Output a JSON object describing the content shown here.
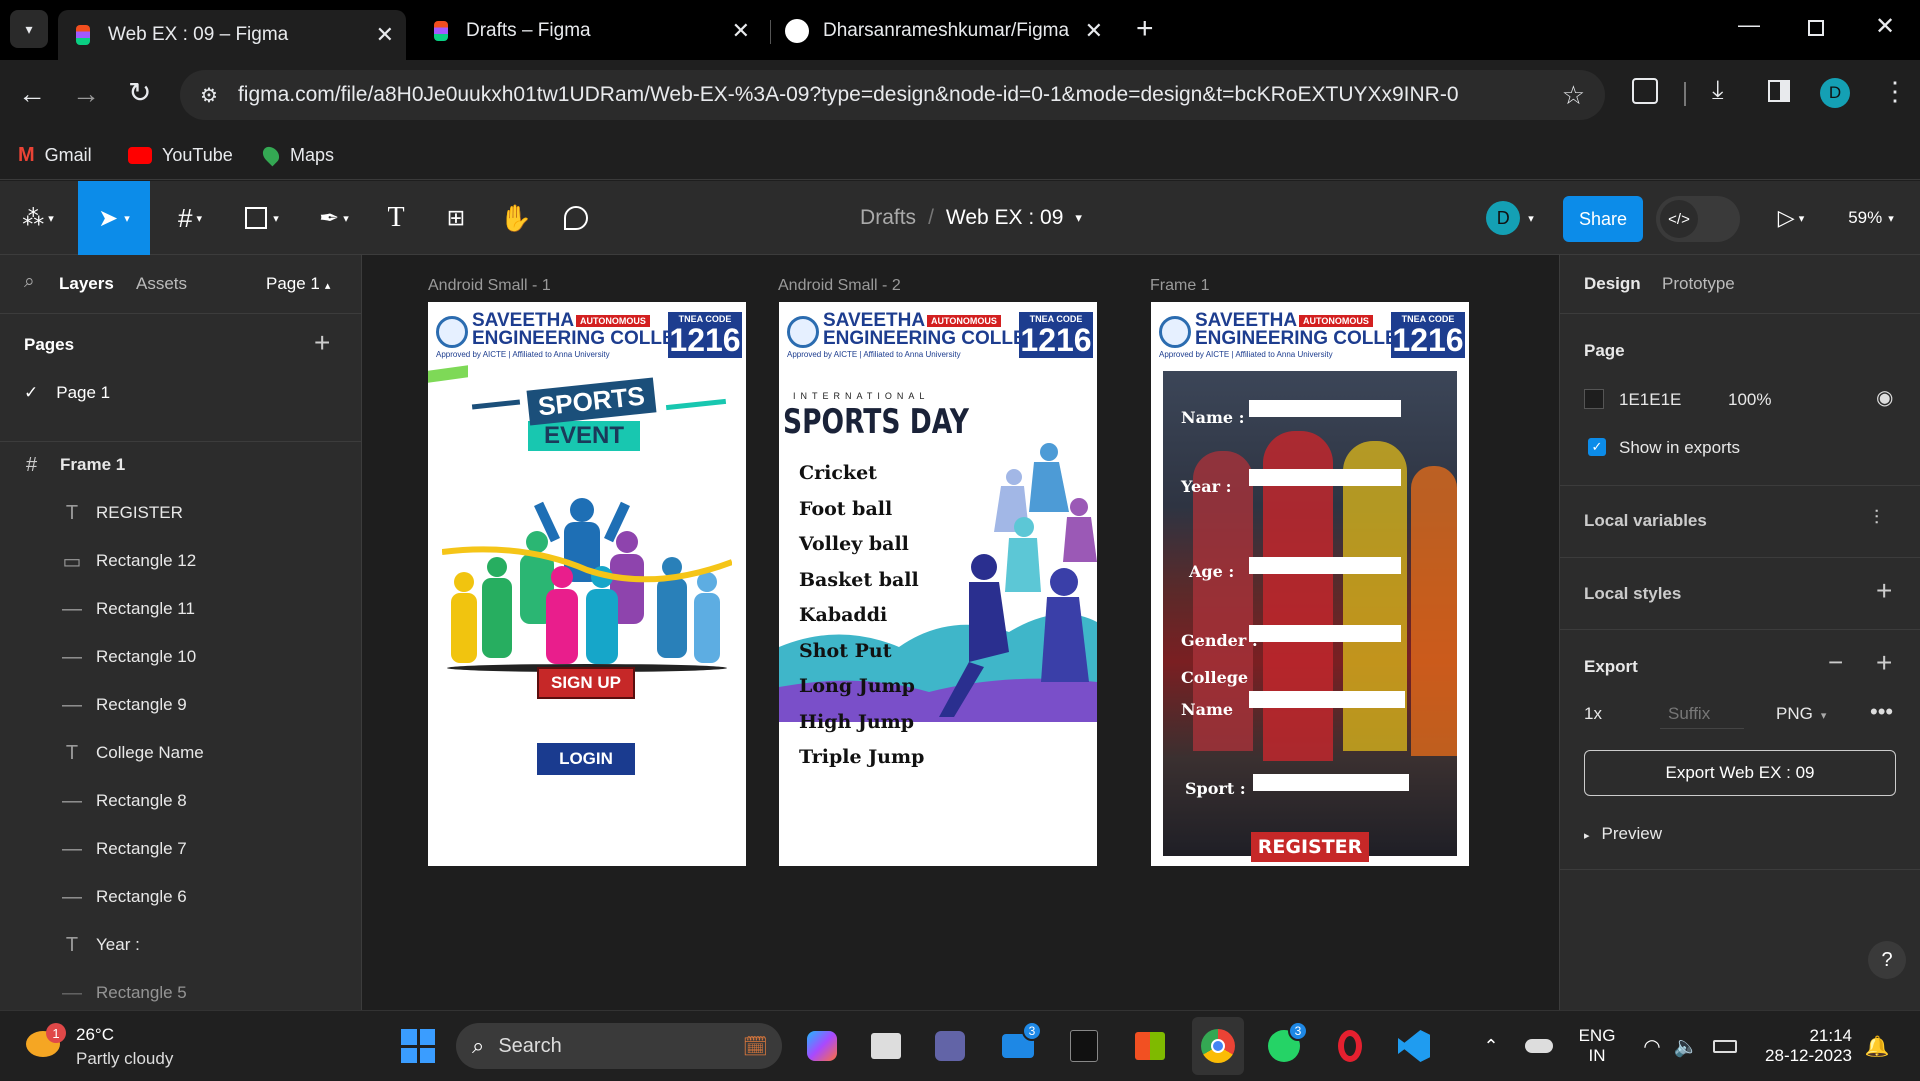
{
  "browser": {
    "tabs": [
      {
        "title": "Web EX : 09 – Figma",
        "active": true,
        "icon": "figma-icon"
      },
      {
        "title": "Drafts – Figma",
        "active": false,
        "icon": "figma-icon"
      },
      {
        "title": "Dharsanrameshkumar/Figma",
        "active": false,
        "icon": "github-icon"
      }
    ],
    "url": "figma.com/file/a8H0Je0uukxh01tw1UDRam/Web-EX-%3A-09?type=design&node-id=0-1&mode=design&t=bcKRoEXTUYXx9INR-0",
    "profile_initial": "D",
    "bookmarks": [
      {
        "label": "Gmail",
        "icon": "gmail-icon"
      },
      {
        "label": "YouTube",
        "icon": "youtube-icon"
      },
      {
        "label": "Maps",
        "icon": "maps-icon"
      }
    ]
  },
  "figma": {
    "breadcrumb": {
      "parent": "Drafts",
      "separator": "/",
      "file": "Web EX : 09"
    },
    "avatar_initial": "D",
    "share_label": "Share",
    "zoom": "59%",
    "left_tabs": {
      "layers": "Layers",
      "assets": "Assets",
      "page": "Page 1"
    },
    "pages_title": "Pages",
    "pages": [
      "Page 1"
    ],
    "frame_title": "Frame 1",
    "layers": [
      {
        "type": "text",
        "name": "REGISTER"
      },
      {
        "type": "rect",
        "name": "Rectangle 12"
      },
      {
        "type": "line",
        "name": "Rectangle 11"
      },
      {
        "type": "line",
        "name": "Rectangle 10"
      },
      {
        "type": "line",
        "name": "Rectangle 9"
      },
      {
        "type": "text",
        "name": "College Name"
      },
      {
        "type": "line",
        "name": "Rectangle 8"
      },
      {
        "type": "line",
        "name": "Rectangle 7"
      },
      {
        "type": "line",
        "name": "Rectangle 6"
      },
      {
        "type": "text",
        "name": "Year :"
      },
      {
        "type": "line",
        "name": "Rectangle 5"
      }
    ],
    "right": {
      "tabs": [
        "Design",
        "Prototype"
      ],
      "page_title": "Page",
      "bg_color": "1E1E1E",
      "bg_opacity": "100%",
      "show_in_exports": "Show in exports",
      "local_variables": "Local variables",
      "local_styles": "Local styles",
      "export_title": "Export",
      "export_scale": "1x",
      "export_suffix_placeholder": "Suffix",
      "export_format": "PNG",
      "export_button": "Export Web EX : 09",
      "preview": "Preview"
    },
    "frames": [
      {
        "label": "Android Small - 1",
        "sign_up": "SIGN UP",
        "login": "LOGIN",
        "banner_line1": "SPORTS",
        "banner_line2": "EVENT"
      },
      {
        "label": "Android Small - 2",
        "kicker": "INTERNATIONAL",
        "title": "SPORTS DAY",
        "sports": [
          "Cricket",
          "Foot ball",
          "Volley ball",
          "Basket ball",
          "Kabaddi",
          "Shot Put",
          "Long Jump",
          "High Jump",
          "Triple Jump"
        ]
      },
      {
        "label": "Frame 1",
        "fields": [
          "Name :",
          "Year :",
          "Age :",
          "Gender :",
          "College",
          "Name",
          "Sport :"
        ],
        "register": "REGISTER"
      }
    ],
    "college": {
      "name_line1": "SAVEETHA",
      "name_line2": "ENGINEERING COLLEGE",
      "autonomous": "AUTONOMOUS",
      "approval": "Approved by AICTE | Affiliated to Anna University",
      "code_label": "TNEA CODE",
      "code": "1216"
    }
  },
  "taskbar": {
    "weather_temp": "26°C",
    "weather_desc": "Partly cloudy",
    "weather_badge": "1",
    "search": "Search",
    "lang1": "ENG",
    "lang2": "IN",
    "time": "21:14",
    "date": "28-12-2023",
    "outlook_badge": "3",
    "whatsapp_badge": "3"
  },
  "colors": {
    "accent": "#0c8ce9",
    "figma_bg": "#2c2c2c",
    "canvas": "#1e1e1e",
    "register_red": "#c62828",
    "login_blue": "#1a3b8f"
  }
}
